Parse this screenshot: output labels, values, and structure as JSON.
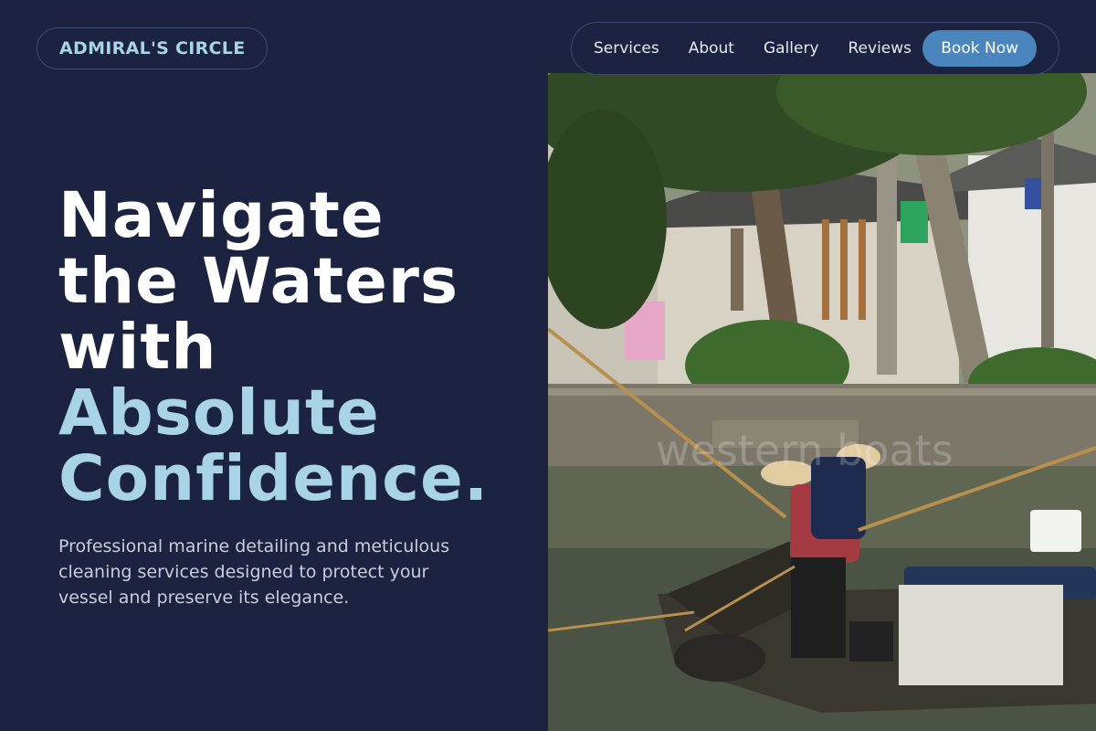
{
  "brand": {
    "name": "ADMIRAL'S CIRCLE"
  },
  "nav": {
    "links": [
      "Services",
      "About",
      "Gallery",
      "Reviews"
    ],
    "cta": "Book Now"
  },
  "hero": {
    "headline_lines": [
      "Navigate",
      "the Waters",
      "with"
    ],
    "headline_accent_lines": [
      "Absolute",
      "Confidence."
    ],
    "subtext": "Professional marine detailing and meticulous cleaning services designed to protect your vessel and preserve its elegance.",
    "image_watermark": "western boats"
  },
  "colors": {
    "background": "#1b2340",
    "accent": "#a9d3e6",
    "button": "#4a86bd",
    "text": "#ffffff"
  }
}
